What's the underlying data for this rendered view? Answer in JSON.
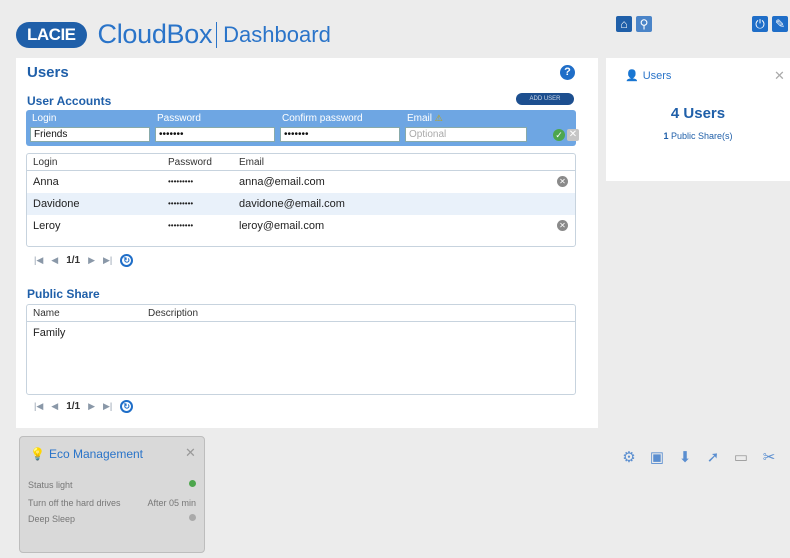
{
  "header": {
    "logo_text": "LACIE",
    "brand": "CloudBox",
    "subtitle": "Dashboard"
  },
  "topbar": {
    "home_icon": "home-icon",
    "search_icon": "search-icon",
    "power_icon": "power-icon",
    "edit_icon": "edit-icon"
  },
  "users": {
    "title": "Users",
    "accounts_heading": "User Accounts",
    "add_user": "ADD USER",
    "form": {
      "login_label": "Login",
      "password_label": "Password",
      "confirm_label": "Confirm password",
      "email_label": "Email",
      "login_value": "Friends",
      "password_value": "•••••••",
      "confirm_value": "•••••••",
      "email_placeholder": "Optional"
    },
    "columns": [
      "Login",
      "Password",
      "Email"
    ],
    "rows": [
      {
        "login": "Anna",
        "password": "•••••••••",
        "email": "anna@email.com"
      },
      {
        "login": "Davidone",
        "password": "•••••••••",
        "email": "davidone@email.com"
      },
      {
        "login": "Leroy",
        "password": "•••••••••",
        "email": "leroy@email.com"
      }
    ],
    "pager": "1/1"
  },
  "public_share": {
    "heading": "Public Share",
    "columns": [
      "Name",
      "Description"
    ],
    "rows": [
      {
        "name": "Family"
      }
    ],
    "pager": "1/1"
  },
  "side": {
    "title": "Users",
    "count": "4 Users",
    "shares_count": "1",
    "shares_label": "Public Share(s)"
  },
  "eco": {
    "title": "Eco Management",
    "rows": [
      {
        "label": "Status light",
        "value": ""
      },
      {
        "label": "Turn off the hard drives",
        "value": "After 05 min"
      },
      {
        "label": "Deep Sleep",
        "value": ""
      }
    ]
  },
  "colors": {
    "accent": "#2a74c9",
    "form_bar": "#6ea6e3",
    "ok": "#4da64d"
  }
}
